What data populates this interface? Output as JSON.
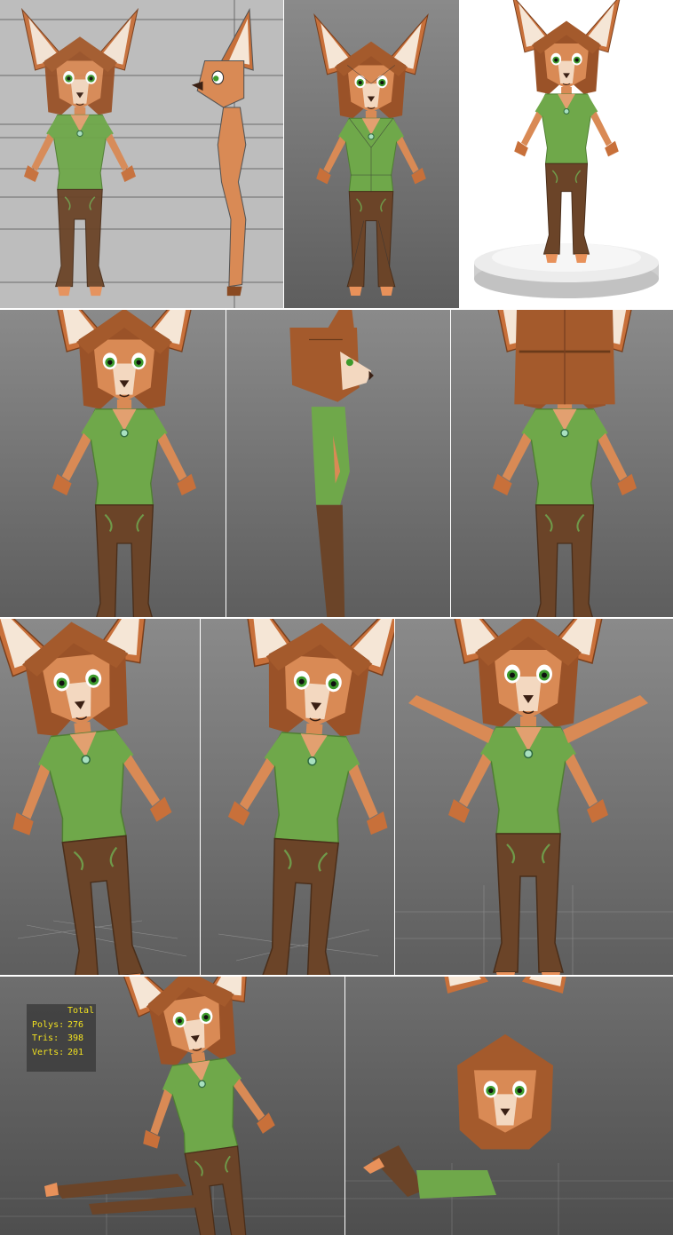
{
  "stats_overlay": {
    "header": "Total",
    "rows": [
      {
        "label": "Polys:",
        "value": "276"
      },
      {
        "label": "Tris:",
        "value": "398"
      },
      {
        "label": "Verts:",
        "value": "201"
      }
    ]
  },
  "colors": {
    "fur": "#c8703a",
    "fur_dark": "#8a4a22",
    "ear_inner": "#f5e6d6",
    "shirt": "#6fa84a",
    "pants": "#6b4428",
    "hair": "#a45a2c",
    "eye": "#5ab43c",
    "viewport_bg": "#7a7a7a",
    "sketch_bg": "#b9b9b9"
  }
}
